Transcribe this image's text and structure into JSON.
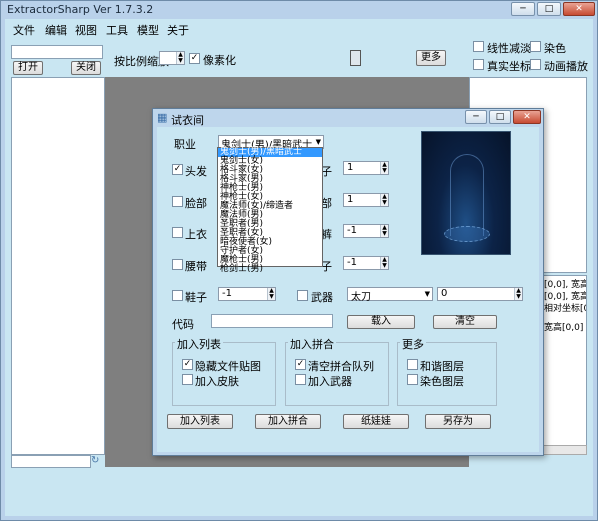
{
  "app": {
    "title": "ExtractorSharp Ver 1.7.3.2"
  },
  "window_buttons": {
    "minimize": "─",
    "maximize": "□",
    "close": "✕"
  },
  "menu": {
    "items": [
      "文件",
      "编辑",
      "视图",
      "工具",
      "模型",
      "关于"
    ]
  },
  "main": {
    "open_button": "打开",
    "close_button": "关闭",
    "scale_label": "按比例缩放",
    "pixelate_label": "像素化",
    "more_button": "更多",
    "linear_fade_label": "线性减淡",
    "color_label": "染色",
    "real_coords_label": "真实坐标",
    "animation_label": "动画播放",
    "side_info_lines": [
      "[0,0], 宽高[0",
      "[0,0], 宽高[0",
      "相对坐标[0",
      "宽高[0,0]"
    ]
  },
  "dialog": {
    "title": "试衣间",
    "job_label": "职业",
    "job_value": "鬼剑士(男)/黑暗武士",
    "dropdown_options": [
      "鬼剑士(男)/黑暗武士",
      "鬼剑士(女)",
      "格斗家(女)",
      "格斗家(男)",
      "神枪士(男)",
      "神枪士(女)",
      "魔法师(女)/缔造者",
      "魔法师(男)",
      "圣职者(男)",
      "圣职者(女)",
      "暗夜使者(女)",
      "守护者(女)",
      "魔枪士(男)",
      "枪剑士(男)"
    ],
    "slots": [
      {
        "label": "头发",
        "checked": true
      },
      {
        "label": "脸部",
        "checked": false
      },
      {
        "label": "上衣",
        "checked": false
      },
      {
        "label": "腰带",
        "checked": false
      },
      {
        "label": "鞋子",
        "checked": false
      }
    ],
    "right_slots": [
      "子",
      "部",
      "裤",
      "子"
    ],
    "right_values": [
      "1",
      "1",
      "-1",
      "-1"
    ],
    "left_values": [
      "-1"
    ],
    "weapon_label": "武器",
    "weapon_value": "太刀",
    "weapon_number": "0",
    "code_label": "代码",
    "code_value": "",
    "load_button": "载入",
    "clear_button": "清空",
    "groups": {
      "add_list": {
        "title": "加入列表",
        "options": [
          {
            "label": "隐藏文件贴图",
            "checked": true
          },
          {
            "label": "加入皮肤",
            "checked": false
          }
        ]
      },
      "add_merge": {
        "title": "加入拼合",
        "options": [
          {
            "label": "清空拼合队列",
            "checked": true
          },
          {
            "label": "加入武器",
            "checked": false
          }
        ]
      },
      "more": {
        "title": "更多",
        "options": [
          {
            "label": "和谐图层",
            "checked": false
          },
          {
            "label": "染色图层",
            "checked": false
          }
        ]
      }
    },
    "buttons": [
      "加入列表",
      "加入拼合",
      "纸娃娃",
      "另存为"
    ]
  },
  "colors": {
    "title_bg": "#b9d1ea",
    "client_bg": "#c9e6f2",
    "canvas_gray": "#7f7f7f",
    "selection": "#3399ff"
  }
}
